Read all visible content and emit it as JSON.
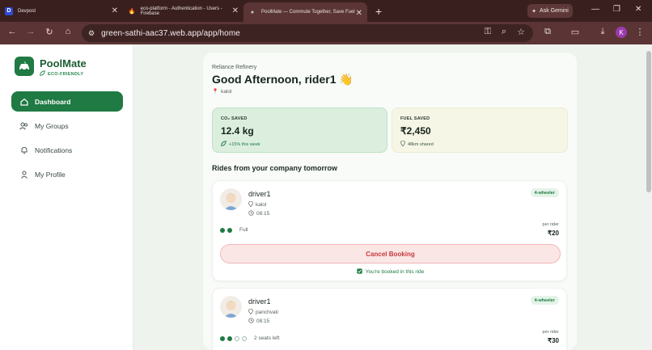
{
  "browser": {
    "tabs": [
      {
        "title": "Devpost",
        "fav": "D",
        "fav_color": "#2e4bd1"
      },
      {
        "title": "eco-platform - Authentication - Users - Firebase",
        "fav": "🔥",
        "fav_color": "#e8710a"
      },
      {
        "title": "PoolMate — Commute Together, Save Fuel",
        "fav": "●",
        "fav_color": "#9aa0a6"
      }
    ],
    "gemini_label": "Ask Gemini",
    "url": "green-sathi-aac37.web.app/app/home",
    "profile_initial": "K"
  },
  "sidebar": {
    "brand": "PoolMate",
    "tagline": "ECO-FRIENDLY",
    "items": [
      {
        "label": "Dashboard",
        "icon": "home-icon",
        "active": true
      },
      {
        "label": "My Groups",
        "icon": "users-icon"
      },
      {
        "label": "Notifications",
        "icon": "bell-icon"
      },
      {
        "label": "My Profile",
        "icon": "user-icon"
      }
    ]
  },
  "main": {
    "company": "Reliance Refinery",
    "greeting": "Good Afternoon, rider1 👋",
    "location": "kalol",
    "stats": {
      "co2": {
        "label": "CO₂ SAVED",
        "value": "12.4 kg",
        "sub": "+15% this week"
      },
      "fuel": {
        "label": "FUEL SAVED",
        "value": "₹2,450",
        "sub": "48km shared"
      }
    },
    "section_title": "Rides from your company tomorrow",
    "rides": [
      {
        "driver": "driver1",
        "place": "kalol",
        "time": "08:15",
        "vehicle": "4-wheeler",
        "seats_text": "Full",
        "seats_filled": 2,
        "seats_total": 2,
        "price_label": "per rider",
        "price": "₹20",
        "action": "Cancel Booking",
        "note": "You're booked in this ride"
      },
      {
        "driver": "driver1",
        "place": "panchvati",
        "time": "08:15",
        "vehicle": "4-wheeler",
        "seats_text": "2 seats left",
        "seats_filled": 2,
        "seats_total": 4,
        "price_label": "per rider",
        "price": "₹30"
      }
    ]
  },
  "colors": {
    "accent": "#1f7a43",
    "danger": "#c6383b"
  }
}
